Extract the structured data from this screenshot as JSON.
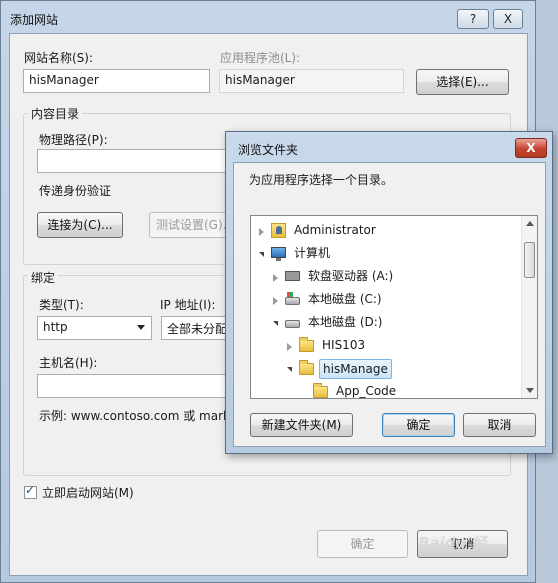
{
  "main_dialog": {
    "title": "添加网站",
    "help_button": "?",
    "close_button": "X",
    "site_name_label": "网站名称(S):",
    "site_name_value": "hisManager",
    "app_pool_label": "应用程序池(L):",
    "app_pool_value": "hisManager",
    "select_button": "选择(E)...",
    "content_group": {
      "title": "内容目录",
      "physical_path_label": "物理路径(P):",
      "physical_path_value": "",
      "pass_through_label": "传递身份验证",
      "connect_as_button": "连接为(C)...",
      "test_settings_button": "测试设置(G)..."
    },
    "binding_group": {
      "title": "绑定",
      "type_label": "类型(T):",
      "type_value": "http",
      "ip_label": "IP 地址(I):",
      "ip_value": "全部未分配",
      "hostname_label": "主机名(H):",
      "hostname_value": "",
      "example_text": "示例: www.contoso.com 或 mark"
    },
    "start_immediately_label": "立即启动网站(M)",
    "start_immediately_checked": true,
    "ok_button": "确定",
    "cancel_button": "取消"
  },
  "browse_dialog": {
    "title": "浏览文件夹",
    "close_button": "X",
    "prompt": "为应用程序选择一个目录。",
    "tree": [
      {
        "label": "Administrator",
        "icon": "user-folder-icon",
        "expand": "closed",
        "level": 0
      },
      {
        "label": "计算机",
        "icon": "computer-icon",
        "expand": "open",
        "level": 0
      },
      {
        "label": "软盘驱动器 (A:)",
        "icon": "floppy-drive-icon",
        "expand": "closed",
        "level": 1
      },
      {
        "label": "本地磁盘 (C:)",
        "icon": "os-drive-icon",
        "expand": "closed",
        "level": 1
      },
      {
        "label": "本地磁盘 (D:)",
        "icon": "drive-icon",
        "expand": "open",
        "level": 1
      },
      {
        "label": "HIS103",
        "icon": "folder-icon",
        "expand": "closed",
        "level": 2
      },
      {
        "label": "hisManage",
        "icon": "folder-icon",
        "expand": "open",
        "level": 2,
        "selected": true
      },
      {
        "label": "App_Code",
        "icon": "folder-icon",
        "expand": "none",
        "level": 3
      }
    ],
    "new_folder_button": "新建文件夹(M)",
    "ok_button": "确定",
    "cancel_button": "取消"
  },
  "watermark": "Baidu 经"
}
